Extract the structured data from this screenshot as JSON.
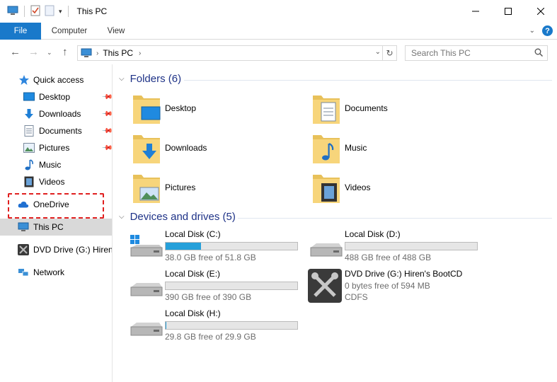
{
  "window": {
    "title": "This PC",
    "controls": {
      "minimize": "—",
      "maximize": "☐",
      "close": "✕"
    }
  },
  "ribbon": {
    "tabs": [
      {
        "label": "File"
      },
      {
        "label": "Computer"
      },
      {
        "label": "View"
      }
    ]
  },
  "address_bar": {
    "path": "This PC",
    "search_placeholder": "Search This PC"
  },
  "sidebar": {
    "quick_access": "Quick access",
    "pinned": [
      {
        "label": "Desktop",
        "icon": "desktop-icon"
      },
      {
        "label": "Downloads",
        "icon": "downloads-icon"
      },
      {
        "label": "Documents",
        "icon": "documents-icon"
      },
      {
        "label": "Pictures",
        "icon": "pictures-icon"
      }
    ],
    "unpinned": [
      {
        "label": "Music",
        "icon": "music-icon"
      },
      {
        "label": "Videos",
        "icon": "videos-icon"
      }
    ],
    "onedrive": "OneDrive",
    "this_pc": "This PC",
    "dvd": "DVD Drive (G:) Hiren's",
    "network": "Network"
  },
  "folders": {
    "header": "Folders (6)",
    "items": [
      {
        "name": "Desktop",
        "icon": "desktop-folder-icon"
      },
      {
        "name": "Documents",
        "icon": "documents-folder-icon"
      },
      {
        "name": "Downloads",
        "icon": "downloads-folder-icon"
      },
      {
        "name": "Music",
        "icon": "music-folder-icon"
      },
      {
        "name": "Pictures",
        "icon": "pictures-folder-icon"
      },
      {
        "name": "Videos",
        "icon": "videos-folder-icon"
      }
    ]
  },
  "drives": {
    "header": "Devices and drives (5)",
    "items": [
      {
        "name": "Local Disk (C:)",
        "free": "38.0 GB free of 51.8 GB",
        "used_fraction": 0.27,
        "icon": "windows-drive-icon"
      },
      {
        "name": "Local Disk (D:)",
        "free": "488 GB free of 488 GB",
        "used_fraction": 0.0,
        "icon": "hard-drive-icon"
      },
      {
        "name": "Local Disk (E:)",
        "free": "390 GB free of 390 GB",
        "used_fraction": 0.0,
        "icon": "hard-drive-icon"
      },
      {
        "name": "DVD Drive (G:) Hiren's BootCD",
        "line2": "0 bytes free of 594 MB",
        "line3": "CDFS",
        "icon": "tools-drive-icon"
      },
      {
        "name": "Local Disk (H:)",
        "free": "29.8 GB free of 29.9 GB",
        "used_fraction": 0.003,
        "icon": "hard-drive-icon"
      }
    ]
  },
  "colors": {
    "accent": "#1979ca",
    "group_title": "#1e3287",
    "bar_fill": "#26a0da",
    "highlight": "#e02020"
  }
}
